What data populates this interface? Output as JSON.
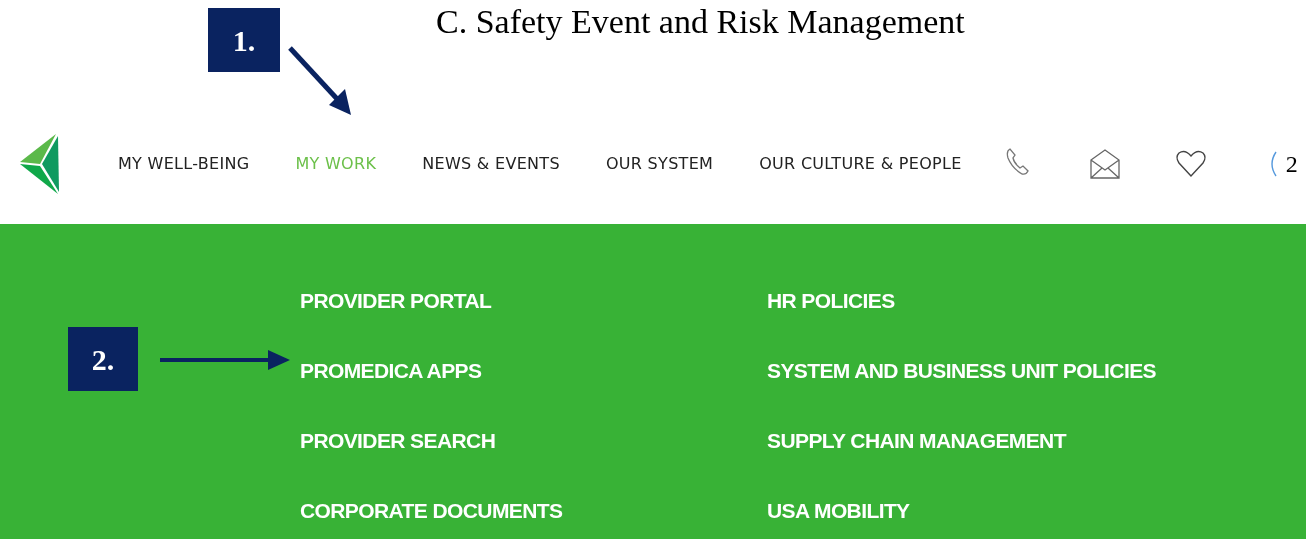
{
  "heading": "C. Safety Event and Risk Management",
  "nav": [
    {
      "label": "MY WELL-BEING",
      "selected": false
    },
    {
      "label": "MY WORK",
      "selected": true
    },
    {
      "label": "NEWS & EVENTS",
      "selected": false
    },
    {
      "label": "OUR SYSTEM",
      "selected": false
    },
    {
      "label": "OUR CULTURE & PEOPLE",
      "selected": false
    }
  ],
  "nav_tools": [
    {
      "kind": "phone"
    },
    {
      "kind": "mail"
    },
    {
      "kind": "heart"
    },
    {
      "kind": "partial"
    }
  ],
  "cart_count": "2",
  "menu_columns": [
    [
      "PROVIDER PORTAL",
      "PROMEDICA APPS",
      "PROVIDER SEARCH",
      "CORPORATE DOCUMENTS"
    ],
    [
      "HR POLICIES",
      "SYSTEM AND BUSINESS UNIT POLICIES",
      "SUPPLY CHAIN MANAGEMENT",
      "USA MOBILITY"
    ]
  ],
  "annotations": [
    {
      "label": "1."
    },
    {
      "label": "2."
    }
  ]
}
